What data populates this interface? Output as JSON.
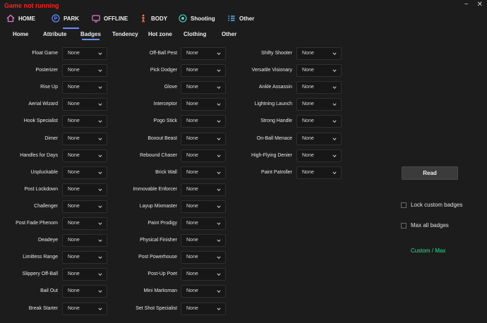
{
  "status": "Game not running",
  "window": {
    "minimize": "−",
    "close": "✕"
  },
  "topnav": [
    {
      "label": "HOME",
      "icon": "home-icon"
    },
    {
      "label": "PARK",
      "icon": "park-icon",
      "active": true
    },
    {
      "label": "OFFLINE",
      "icon": "monitor-icon"
    },
    {
      "label": "BODY",
      "icon": "body-icon"
    },
    {
      "label": "Shooting",
      "icon": "target-icon"
    },
    {
      "label": "Other",
      "icon": "list-icon"
    }
  ],
  "subnav": [
    "Home",
    "Attribute",
    "Badges",
    "Tendency",
    "Hot zone",
    "Clothing",
    "Other"
  ],
  "active_subnav": "Badges",
  "select_default": "None",
  "col1": [
    "Float Game",
    "Posterizer",
    "Rise Up",
    "Aerial Wizard",
    "Hook Specialist",
    "Dimer",
    "Handles for Days",
    "Unpluckable",
    "Post Lockdown",
    "Challenger",
    "Post Fade Phenom",
    "Deadeye",
    "Limitless Range",
    "Slippery Off-Ball",
    "Bail Out",
    "Break Starter"
  ],
  "col2": [
    "Off-Ball Pest",
    "Pick Dodger",
    "Glove",
    "Interceptor",
    "Pogo Stick",
    "Boxout Beast",
    "Rebound Chaser",
    "Brick Wall",
    "Immovable Enforcer",
    "Layup Mixmaster",
    "Paint Prodigy",
    "Physical Finisher",
    "Post Powerhouse",
    "Post-Up Poet",
    "Mini Marksman",
    "Set Shot Specialist"
  ],
  "col3": [
    "Shifty Shooter",
    "Versatile Visionary",
    "Ankle Assassin",
    "Lightning Launch",
    "Strong Handle",
    "On-Ball Menace",
    "High-Flying Denier",
    "Paint Patroller"
  ],
  "side": {
    "read_label": "Read",
    "lock_label": "Lock custom badges",
    "max_label": "Max all badges",
    "mode_label": "Custom / Max",
    "mode_color": "#22e39a",
    "accent": "#6a8cff"
  }
}
